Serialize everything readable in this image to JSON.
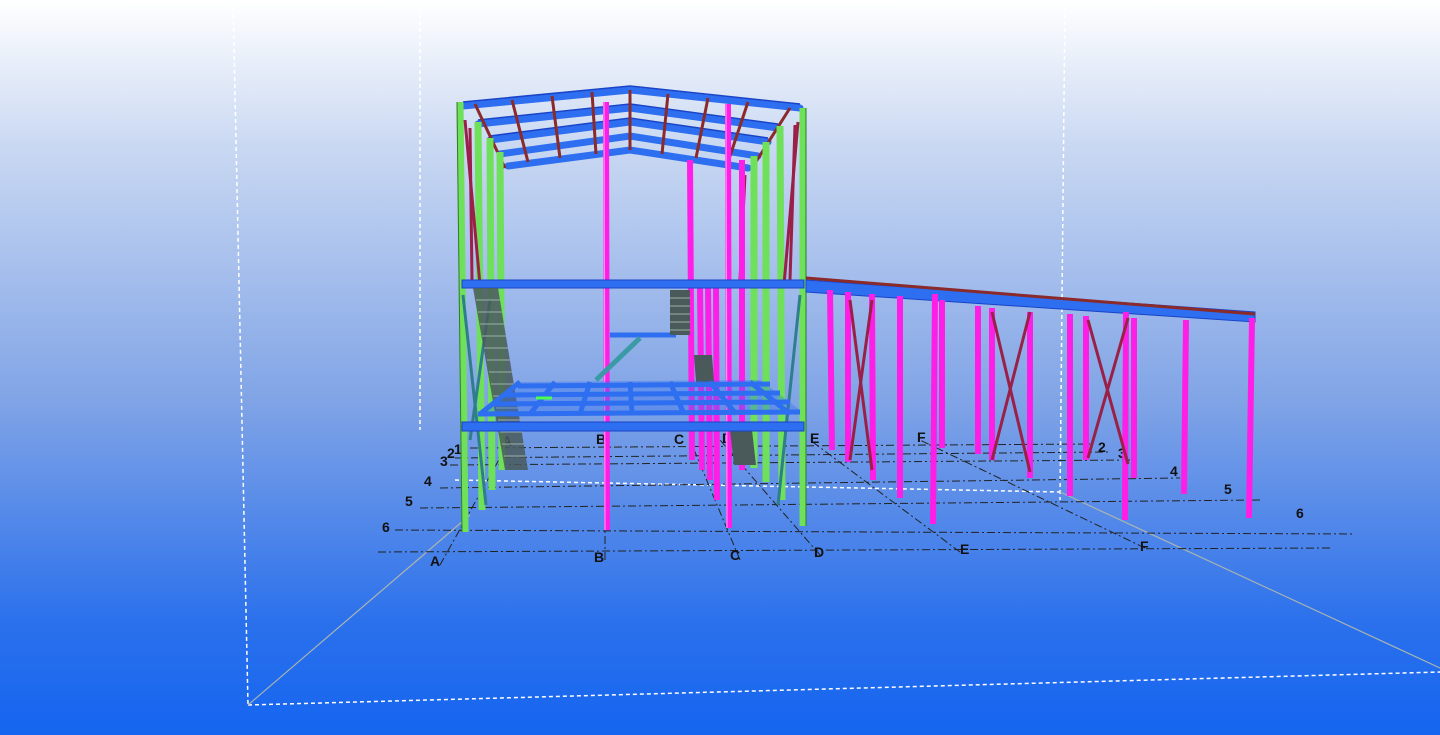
{
  "viewport": {
    "name": "3D model view",
    "colors": {
      "column_primary": "#ff1ee6",
      "column_secondary": "#6ee05a",
      "beam": "#2e6ef0",
      "beam_dark": "#1a44c8",
      "purlin": "#8a2a2a",
      "brace": "#9b2048",
      "stair": "#4a5a5a",
      "stair_rail": "#3a9aa6",
      "gridline": "#222222",
      "box_outline": "#ffffff"
    }
  },
  "grid": {
    "letters": [
      "A",
      "B",
      "C",
      "D",
      "E",
      "F"
    ],
    "numbers": [
      "1",
      "2",
      "3",
      "4",
      "5",
      "6"
    ]
  }
}
